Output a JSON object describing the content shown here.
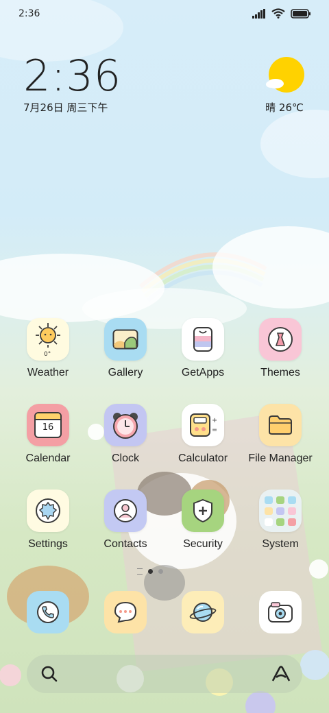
{
  "status_bar": {
    "time": "2:36"
  },
  "lock_widget": {
    "time": "2:36",
    "date": "7月26日 周三下午"
  },
  "weather_widget": {
    "condition": "晴",
    "temperature": "26℃"
  },
  "apps": [
    {
      "name": "Weather",
      "badge": "0°"
    },
    {
      "name": "Gallery"
    },
    {
      "name": "GetApps"
    },
    {
      "name": "Themes"
    },
    {
      "name": "Calendar",
      "day": "16"
    },
    {
      "name": "Clock"
    },
    {
      "name": "Calculator"
    },
    {
      "name": "File Manager"
    },
    {
      "name": "Settings"
    },
    {
      "name": "Contacts"
    },
    {
      "name": "Security"
    },
    {
      "name": "System"
    }
  ],
  "dock": [
    "phone-icon",
    "messages-icon",
    "browser-icon",
    "camera-icon"
  ],
  "colors": {
    "sky": "#d7edf9",
    "grass": "#cfe3bc",
    "sun": "#ffd200"
  }
}
